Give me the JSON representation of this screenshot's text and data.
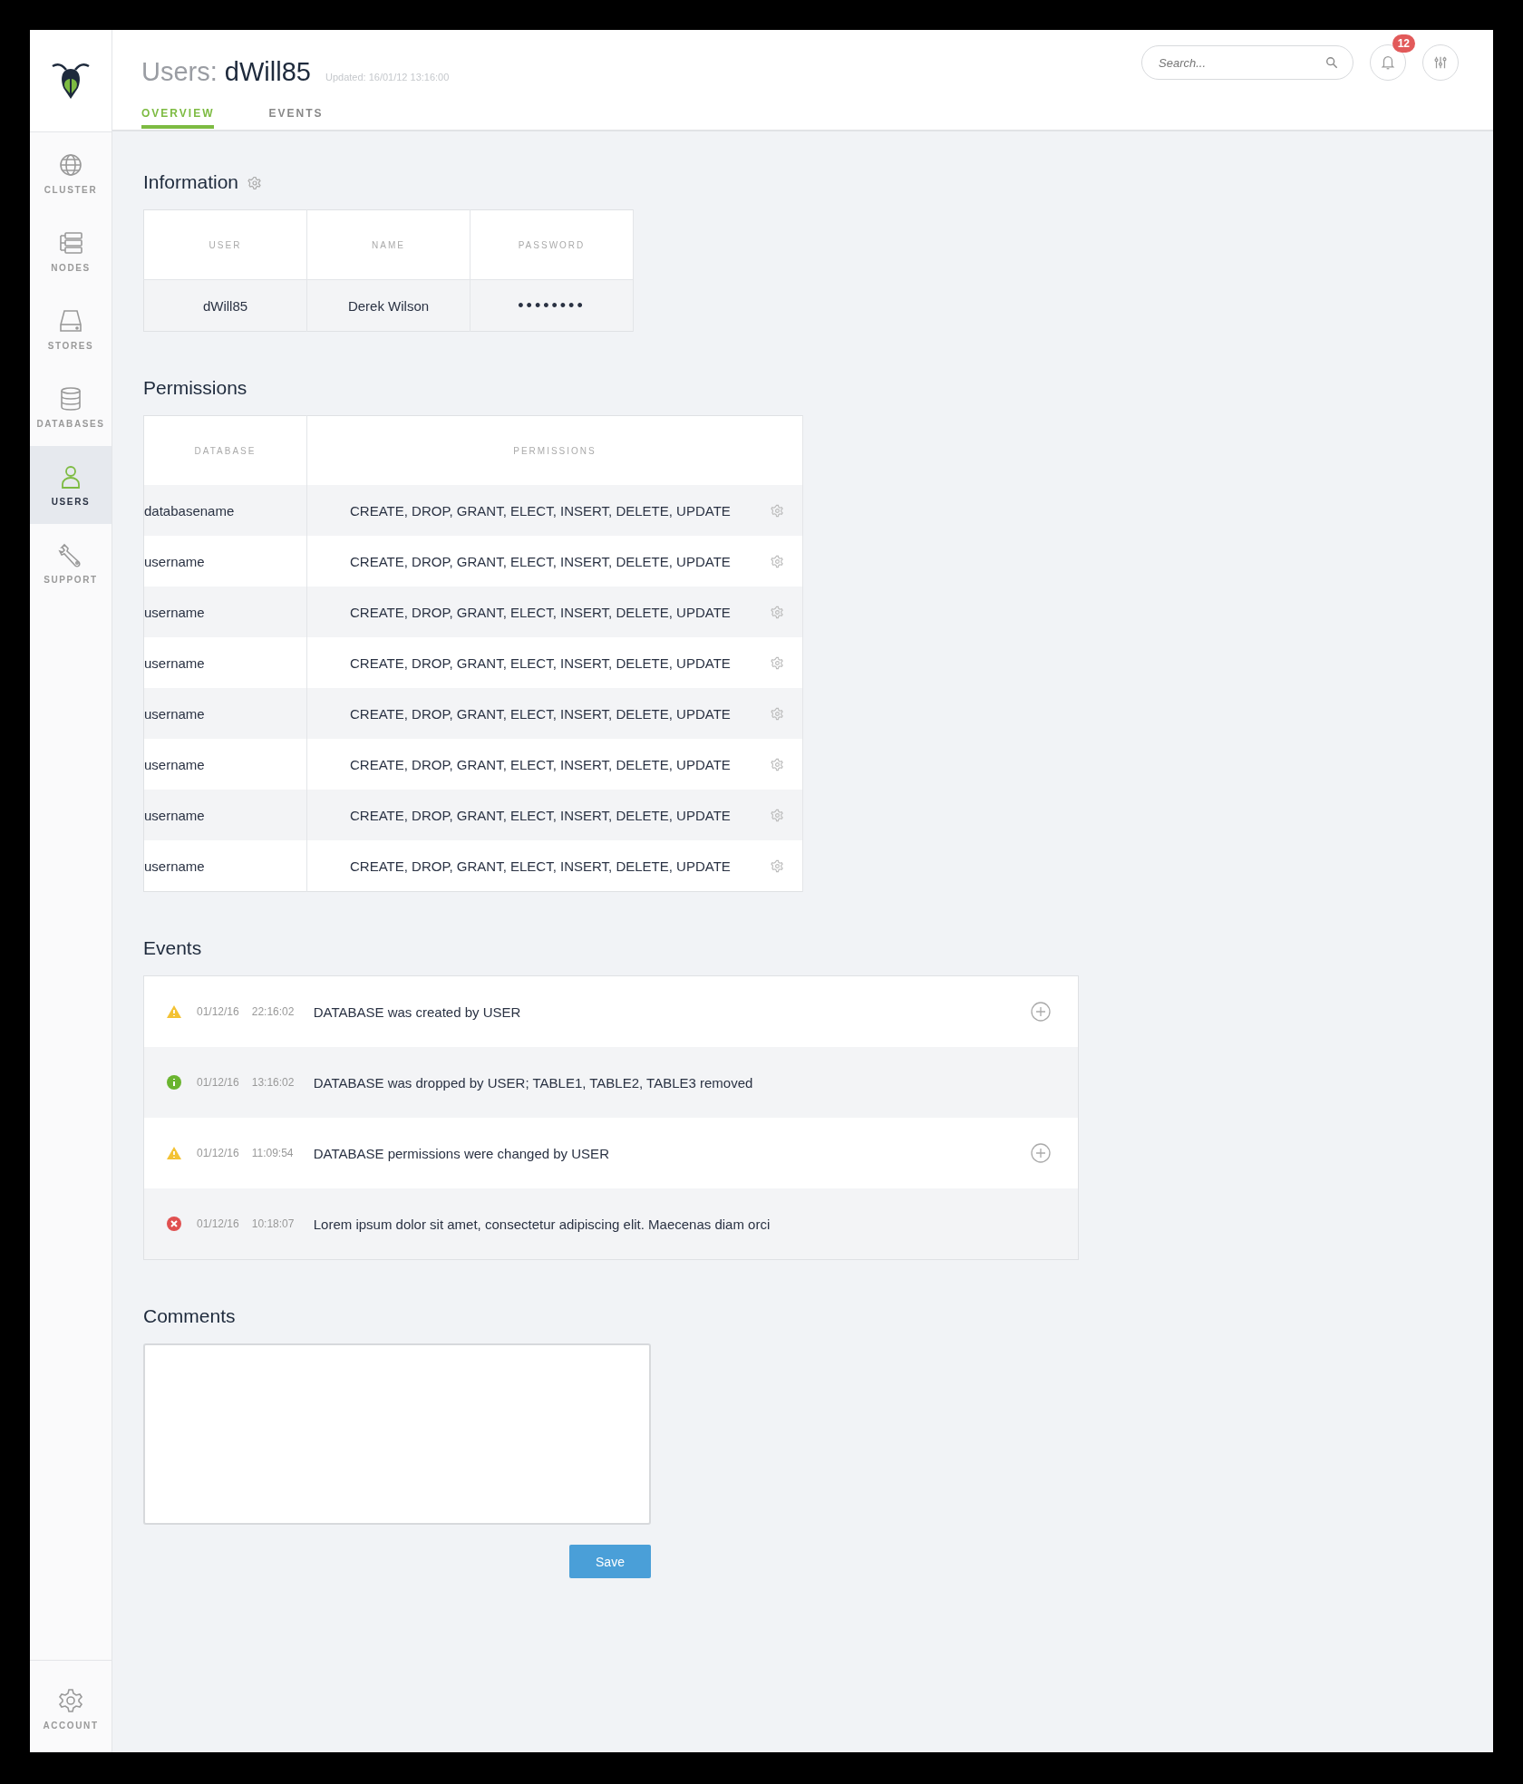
{
  "sidebar": {
    "items": [
      {
        "label": "CLUSTER",
        "selected": false
      },
      {
        "label": "NODES",
        "selected": false
      },
      {
        "label": "STORES",
        "selected": false
      },
      {
        "label": "DATABASES",
        "selected": false
      },
      {
        "label": "USERS",
        "selected": true
      },
      {
        "label": "SUPPORT",
        "selected": false
      }
    ],
    "footer_item": {
      "label": "ACCOUNT",
      "selected": false
    }
  },
  "header": {
    "title_prefix": "Users:",
    "title_name": "dWill85",
    "updated": "Updated: 16/01/12 13:16:00",
    "tabs": [
      {
        "label": "OVERVIEW",
        "selected": true
      },
      {
        "label": "EVENTS",
        "selected": false
      }
    ],
    "search": {
      "placeholder": "Search..."
    },
    "notification_count": "12"
  },
  "information": {
    "title": "Information",
    "columns": [
      "USER",
      "NAME",
      "PASSWORD"
    ],
    "row": [
      "dWill85",
      "Derek Wilson",
      "••••••••"
    ]
  },
  "permissions": {
    "title": "Permissions",
    "columns": [
      "DATABASE",
      "PERMISSIONS"
    ],
    "rows": [
      {
        "database": "databasename",
        "permissions": "CREATE, DROP, GRANT, ELECT, INSERT, DELETE, UPDATE"
      },
      {
        "database": "username",
        "permissions": "CREATE, DROP, GRANT, ELECT, INSERT, DELETE, UPDATE"
      },
      {
        "database": "username",
        "permissions": "CREATE, DROP, GRANT, ELECT, INSERT, DELETE, UPDATE"
      },
      {
        "database": "username",
        "permissions": "CREATE, DROP, GRANT, ELECT, INSERT, DELETE, UPDATE"
      },
      {
        "database": "username",
        "permissions": "CREATE, DROP, GRANT, ELECT, INSERT, DELETE, UPDATE"
      },
      {
        "database": "username",
        "permissions": "CREATE, DROP, GRANT, ELECT, INSERT, DELETE, UPDATE"
      },
      {
        "database": "username",
        "permissions": "CREATE, DROP, GRANT, ELECT, INSERT, DELETE, UPDATE"
      },
      {
        "database": "username",
        "permissions": "CREATE, DROP, GRANT, ELECT, INSERT, DELETE, UPDATE"
      }
    ]
  },
  "events": {
    "title": "Events",
    "rows": [
      {
        "kind": "warning",
        "date": "01/12/16",
        "time": "22:16:02",
        "message": "DATABASE was created by USER",
        "expandable": true
      },
      {
        "kind": "info",
        "date": "01/12/16",
        "time": "13:16:02",
        "message": "DATABASE was dropped by USER; TABLE1, TABLE2, TABLE3 removed",
        "expandable": false
      },
      {
        "kind": "warning",
        "date": "01/12/16",
        "time": "11:09:54",
        "message": "DATABASE permissions were changed by USER",
        "expandable": true
      },
      {
        "kind": "error",
        "date": "01/12/16",
        "time": "10:18:07",
        "message": "Lorem ipsum dolor sit amet, consectetur adipiscing elit. Maecenas diam orci",
        "expandable": false
      }
    ]
  },
  "comments": {
    "title": "Comments",
    "save_button": "Save"
  }
}
